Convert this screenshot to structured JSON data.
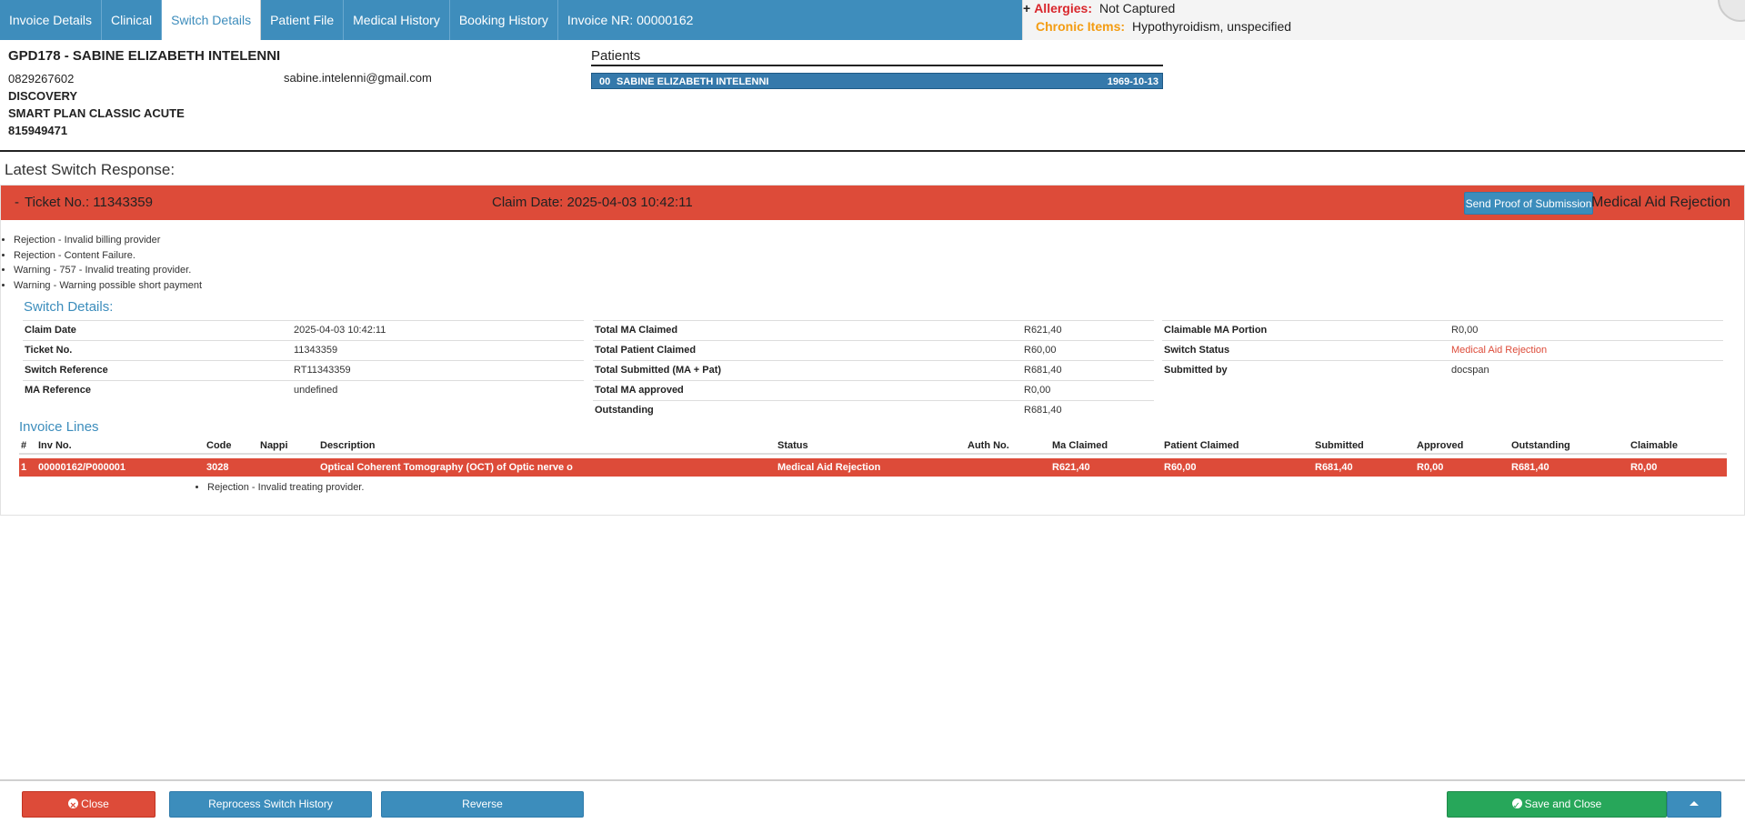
{
  "tabs": [
    {
      "label": "Invoice Details"
    },
    {
      "label": "Clinical"
    },
    {
      "label": "Switch Details"
    },
    {
      "label": "Patient File"
    },
    {
      "label": "Medical History"
    },
    {
      "label": "Booking History"
    }
  ],
  "invoice_nr": "Invoice NR: 00000162",
  "alerts": {
    "plus": "+",
    "allergies_label": "Allergies:",
    "allergies_value": "Not Captured",
    "chronic_label": "Chronic Items:",
    "chronic_value": "Hypothyroidism, unspecified"
  },
  "patient": {
    "title": "GPD178 - SABINE ELIZABETH INTELENNI",
    "phone": "0829267602",
    "email": "sabine.intelenni@gmail.com",
    "medical_aid": "DISCOVERY",
    "plan": "SMART PLAN CLASSIC ACUTE",
    "member_no": "815949471"
  },
  "patients_panel": {
    "title": "Patients",
    "rows": [
      {
        "num": "00",
        "name": "SABINE ELIZABETH INTELENNI",
        "dob": "1969-10-13"
      }
    ]
  },
  "latest_title": "Latest Switch Response:",
  "response": {
    "collapse": "-",
    "ticket": "Ticket No.: 11343359",
    "claim_date": "Claim Date: 2025-04-03 10:42:11",
    "proof_button": "Send Proof of Submission",
    "status": "Medical Aid Rejection",
    "messages": [
      "Rejection - Invalid billing provider",
      "Rejection - Content Failure.",
      "Warning - 757 - Invalid treating provider.",
      "Warning - Warning possible short payment"
    ]
  },
  "switch_details": {
    "title": "Switch Details:",
    "col1": [
      {
        "k": "Claim Date",
        "v": "2025-04-03 10:42:11"
      },
      {
        "k": "Ticket No.",
        "v": "11343359"
      },
      {
        "k": "Switch Reference",
        "v": "RT11343359"
      },
      {
        "k": "MA Reference",
        "v": "undefined"
      }
    ],
    "col2": [
      {
        "k": "Total MA Claimed",
        "v": "R621,40"
      },
      {
        "k": "Total Patient Claimed",
        "v": "R60,00"
      },
      {
        "k": "Total Submitted (MA + Pat)",
        "v": "R681,40"
      },
      {
        "k": "Total MA approved",
        "v": "R0,00"
      },
      {
        "k": "Outstanding",
        "v": "R681,40"
      }
    ],
    "col3": [
      {
        "k": "Claimable MA Portion",
        "v": "R0,00"
      },
      {
        "k": "Switch Status",
        "v": "Medical Aid Rejection"
      },
      {
        "k": "Submitted by",
        "v": "docspan"
      }
    ]
  },
  "invoice_lines": {
    "title": "Invoice Lines",
    "headers": {
      "num": "#",
      "inv": "Inv No.",
      "code": "Code",
      "nappi": "Nappi",
      "desc": "Description",
      "status": "Status",
      "auth": "Auth No.",
      "ma": "Ma Claimed",
      "pat": "Patient Claimed",
      "sub": "Submitted",
      "appr": "Approved",
      "outs": "Outstanding",
      "claim": "Claimable"
    },
    "rows": [
      {
        "num": "1",
        "inv": "00000162/P000001",
        "code": "3028",
        "nappi": "",
        "desc": "Optical Coherent Tomography (OCT) of Optic nerve o",
        "status": "Medical Aid Rejection",
        "auth": "",
        "ma": "R621,40",
        "pat": "R60,00",
        "sub": "R681,40",
        "appr": "R0,00",
        "outs": "R681,40",
        "claim": "R0,00",
        "message": "Rejection - Invalid treating provider."
      }
    ]
  },
  "footer": {
    "close": "Close",
    "reprocess": "Reprocess Switch History",
    "reverse": "Reverse",
    "save": "Save and Close"
  },
  "colors": {
    "tab_bar": "#3e8dbc",
    "rejection_red": "#dd4b39",
    "primary_blue": "#3c8dbc",
    "success_green": "#27a75a",
    "allergy_red": "#d9262c",
    "chronic_orange": "#f39c12"
  }
}
